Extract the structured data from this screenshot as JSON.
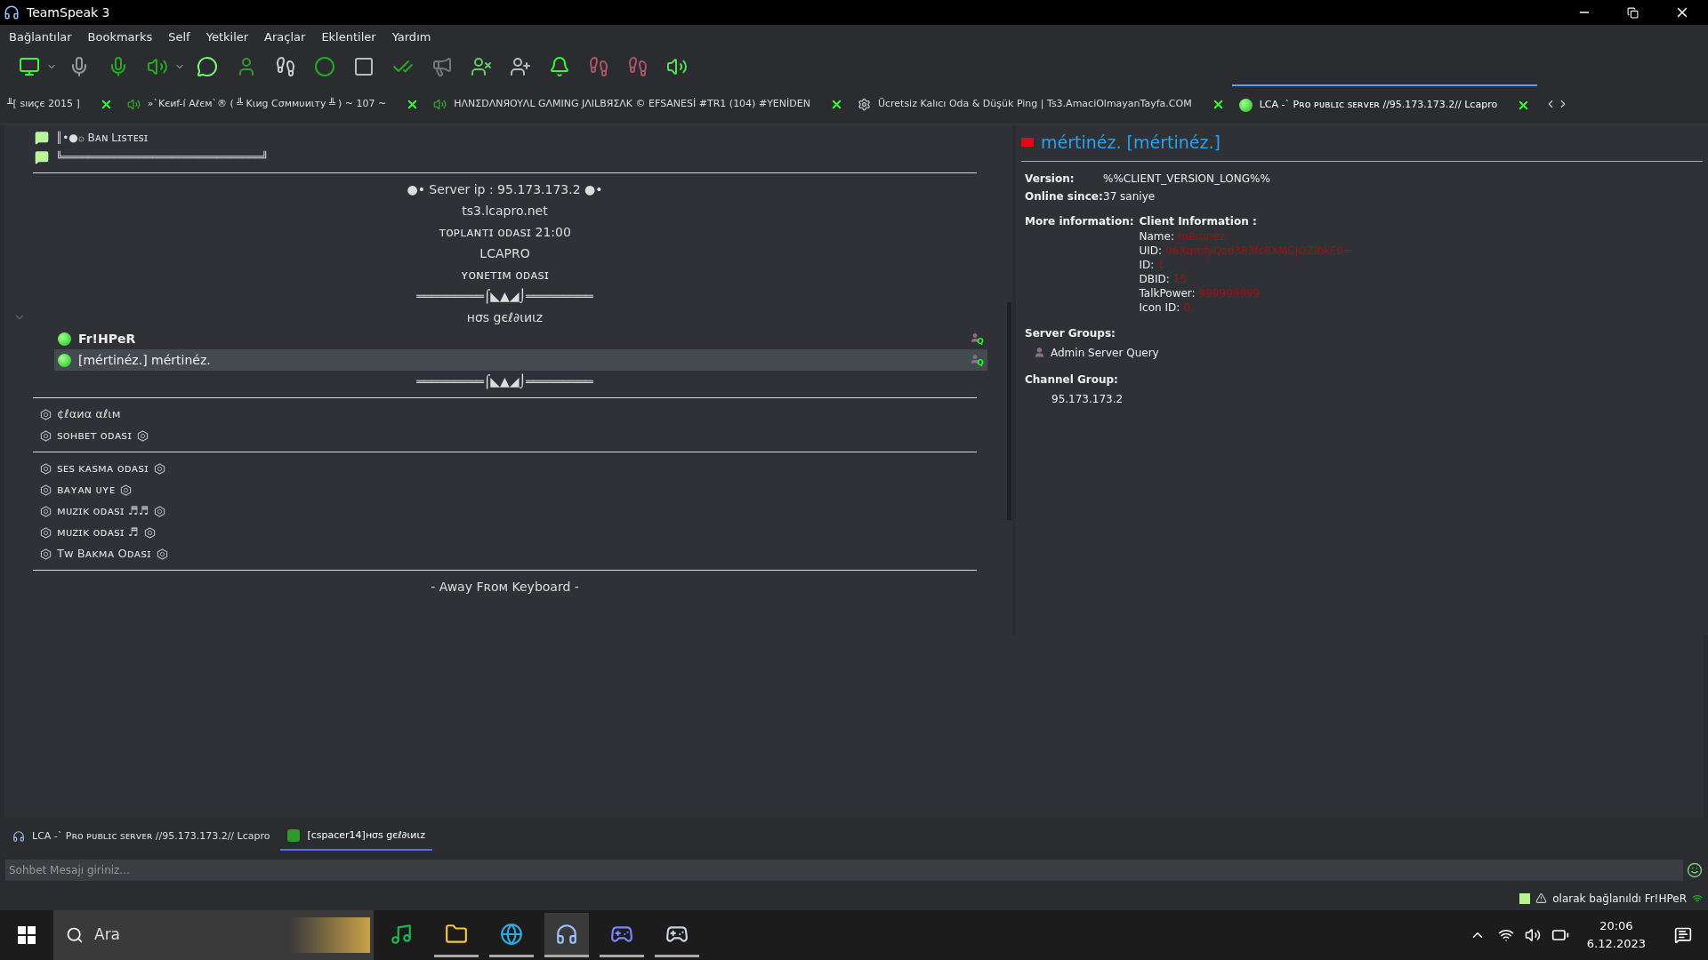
{
  "window": {
    "title": "TeamSpeak 3"
  },
  "menu": [
    "Bağlantılar",
    "Bookmarks",
    "Self",
    "Yetkiler",
    "Araçlar",
    "Eklentiler",
    "Yardım"
  ],
  "server_tabs": [
    {
      "label": "╨[ sıиçє 2015 ]",
      "selected": false,
      "kind": "none"
    },
    {
      "label": "»`Kєиf-í Aℓєм`® ( ╩ Kιиg Cσммυиιтy ╩ ) ~ 107 ~",
      "selected": false,
      "kind": "muted"
    },
    {
      "label": "HΛNΣDΛNЯOYΛL GΛMING JΛILBЯΣΛK © EFSANESİ #TR1 (104) #YENİDEN",
      "selected": false,
      "kind": "muted"
    },
    {
      "label": "Ücretsiz Kalıcı Oda & Düşük Ping | Ts3.AmaciOlmayanTayfa.COM",
      "selected": false,
      "kind": "gear"
    },
    {
      "label": "LCA -` Pʀᴏ ᴘᴜʙʟɪᴄ sᴇʀᴠᴇʀ //95.173.173.2// Lcapro",
      "selected": true,
      "kind": "online"
    }
  ],
  "tree": [
    {
      "kind": "chat",
      "text": "║•●۞ Bᴀɴ Lɪsᴛᴇsɪ"
    },
    {
      "kind": "chat",
      "text": "╚═══════════════════════════════╝"
    },
    {
      "kind": "rule"
    },
    {
      "kind": "spacer",
      "text": "●• Server ip : 95.173.173.2 ●•"
    },
    {
      "kind": "spacer",
      "text": "ts3.lcapro.net"
    },
    {
      "kind": "spacer",
      "text": "ᴛᴏᴘʟᴀɴᴛɪ ᴏᴅᴀsɪ 21:00"
    },
    {
      "kind": "spacer",
      "text": "LCAPRO"
    },
    {
      "kind": "spacer",
      "text": "ʏᴏɴᴇᴛɪᴍ ᴏᴅᴀsɪ"
    },
    {
      "kind": "spacer",
      "text": "═════════⌠◣▲◢⌡═════════"
    },
    {
      "kind": "spacer",
      "text": "нσѕ gєℓ∂ιиιz",
      "expanded": true
    },
    {
      "kind": "client",
      "text": "Fr!HPeR",
      "self": true,
      "selected": false,
      "badge": "Q"
    },
    {
      "kind": "client",
      "text": "[mértinéz.] mértinéz.",
      "self": false,
      "selected": true,
      "badge": "Q"
    },
    {
      "kind": "spacer",
      "text": "═════════⌠◣▲◢⌡═════════"
    },
    {
      "kind": "rule"
    },
    {
      "kind": "channel",
      "text": "¢ℓαиα αℓιм",
      "trail": false
    },
    {
      "kind": "channel",
      "text": "sᴏʜʙᴇᴛ ᴏᴅᴀsɪ",
      "trail": true
    },
    {
      "kind": "rule"
    },
    {
      "kind": "channel",
      "text": "sᴇs ᴋᴀsᴍᴀ ᴏᴅᴀsɪ",
      "trail": true
    },
    {
      "kind": "channel",
      "text": "ʙᴀʏᴀɴ ᴜʏᴇ",
      "trail": true
    },
    {
      "kind": "channel",
      "text": "ᴍᴜᴢɪᴋ ᴏᴅᴀsɪ ♬♬",
      "trail": true
    },
    {
      "kind": "channel",
      "text": "ᴍᴜᴢɪᴋ ᴏᴅᴀsɪ ♬",
      "trail": true
    },
    {
      "kind": "channel",
      "text": "Tᴡ Bᴀᴋᴍᴀ Oᴅᴀsɪ",
      "trail": true
    },
    {
      "kind": "rule"
    },
    {
      "kind": "spacer",
      "text": "- Away Fʀᴏᴍ Keyboard -"
    }
  ],
  "info": {
    "title": "mértinéz. [mértinéz.]",
    "rows": [
      {
        "label": "Version:",
        "value": "%%CLIENT_VERSION_LONG%%"
      },
      {
        "label": "Online since:",
        "value": "37 saniye"
      }
    ],
    "more_label": "More information:",
    "more_heading": "Client Information :",
    "details": [
      {
        "label": "Name:",
        "value": "mértinéz."
      },
      {
        "label": "UID:",
        "value": "06XqmfyQzd383fc8XMCJOZIbkE0="
      },
      {
        "label": "ID:",
        "value": "1"
      },
      {
        "label": "DBID:",
        "value": "15"
      },
      {
        "label": "TalkPower:",
        "value": "999999999"
      },
      {
        "label": "Icon ID:",
        "value": "0"
      }
    ],
    "server_groups_label": "Server Groups:",
    "server_groups": [
      "Admin Server Query"
    ],
    "channel_group_label": "Channel Group:",
    "channel_group": "95.173.173.2"
  },
  "chat_tabs": [
    {
      "label": "LCA -` Pʀᴏ ᴘᴜʙʟɪᴄ sᴇʀᴠᴇʀ //95.173.173.2// Lcapro",
      "selected": false,
      "kind": "server"
    },
    {
      "label": "[cspacer14]нσѕ gєℓ∂ιиιz",
      "selected": true,
      "kind": "channel"
    }
  ],
  "chat_input": {
    "placeholder": "Sohbet Mesajı giriniz..."
  },
  "status_bar": {
    "text": "olarak bağlanıldı Fr!HPeR"
  },
  "taskbar": {
    "search_placeholder": "Ara",
    "apps": [
      {
        "kind": "spotify",
        "open": false,
        "selected": false
      },
      {
        "kind": "files",
        "open": true,
        "selected": false
      },
      {
        "kind": "edge",
        "open": true,
        "selected": false
      },
      {
        "kind": "teamspeak",
        "open": true,
        "selected": true
      },
      {
        "kind": "discord",
        "open": true,
        "selected": false
      },
      {
        "kind": "steam",
        "open": true,
        "selected": false
      }
    ],
    "time": "20:06",
    "date": "6.12.2023"
  }
}
